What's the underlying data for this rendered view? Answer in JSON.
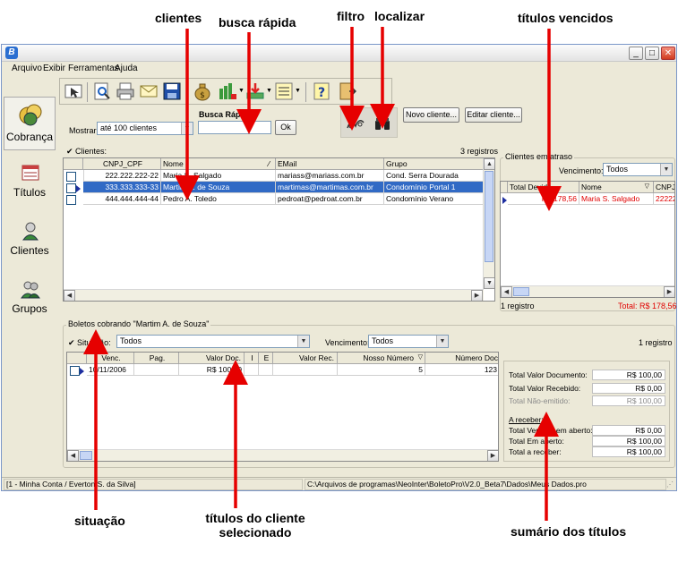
{
  "annotations": {
    "clientes": "clientes",
    "busca_rapida": "busca rápida",
    "filtro": "filtro",
    "localizar": "localizar",
    "titulos_vencidos": "títulos vencidos",
    "situacao": "situação",
    "titulos_cliente_l1": "títulos do cliente",
    "titulos_cliente_l2": "selecionado",
    "sumario": "sumário dos títulos"
  },
  "window": {
    "app_icon": "B"
  },
  "menu": {
    "items": [
      "Arquivo",
      "Exibir",
      "Ferramentas",
      "Ajuda"
    ]
  },
  "sidebar": {
    "items": [
      {
        "label": "Cobrança",
        "icon": "coins-icon"
      },
      {
        "label": "Títulos",
        "icon": "ledger-icon"
      },
      {
        "label": "Clientes",
        "icon": "person-icon"
      },
      {
        "label": "Grupos",
        "icon": "group-icon"
      }
    ]
  },
  "search": {
    "mostrar_label": "Mostrar:",
    "mostrar_value": "até 100 clientes",
    "busca_label": "Busca Rápida",
    "ok": "Ok",
    "novo_cliente": "Novo cliente...",
    "editar_cliente": "Editar cliente..."
  },
  "clients": {
    "label": "Clientes:",
    "count": "3 registros",
    "columns": [
      "CNPJ_CPF",
      "Nome",
      "EMail",
      "Grupo"
    ],
    "rows": [
      {
        "cnpj": "222.222.222-22",
        "nome": "Maria S. Salgado",
        "email": "mariass@mariass.com.br",
        "grupo": "Cond. Serra Dourada"
      },
      {
        "cnpj": "333.333.333-33",
        "nome": "Martim A. de Souza",
        "email": "martimas@martimas.com.br",
        "grupo": "Condomínio Portal 1"
      },
      {
        "cnpj": "444.444.444-44",
        "nome": "Pedro A. Toledo",
        "email": "pedroat@pedroat.com.br",
        "grupo": "Condomínio Verano"
      }
    ]
  },
  "atraso": {
    "title": "Clientes em atraso",
    "vencimento_label": "Vencimento:",
    "vencimento_value": "Todos",
    "columns": [
      "Total Devido",
      "Nome",
      "CNPJ"
    ],
    "row": {
      "total": "R$ 178,56",
      "nome": "Maria S. Salgado",
      "cnpj": "22222"
    },
    "count": "1 registro",
    "total": "Total: R$ 178,56"
  },
  "boletos": {
    "title": "Boletos cobrando \"Martim A. de Souza\"",
    "situacao_label": "Situação:",
    "situacao_value": "Todos",
    "vencimento_label": "Vencimento:",
    "vencimento_value": "Todos",
    "count": "1 registro",
    "columns": [
      "Venc.",
      "Pag.",
      "Valor Doc.",
      "I",
      "E",
      "Valor Rec.",
      "Nosso Número",
      "Número Doc"
    ],
    "row": {
      "venc": "10/11/2006",
      "pag": "",
      "valor_doc": "R$ 100,00",
      "nosso": "5",
      "numero": "123"
    }
  },
  "summary": {
    "items": [
      {
        "label": "Total Valor Documento:",
        "value": "R$ 100,00"
      },
      {
        "label": "Total Valor Recebido:",
        "value": "R$ 0,00"
      },
      {
        "label": "Total Não-emitido:",
        "value": "R$ 100,00"
      }
    ],
    "receber_title": "A receber:",
    "receber": [
      {
        "label": "Total Vencido em aberto:",
        "value": "R$ 0,00"
      },
      {
        "label": "Total Em aberto:",
        "value": "R$ 100,00"
      },
      {
        "label": "Total a receber:",
        "value": "R$ 100,00"
      }
    ]
  },
  "status": {
    "left": "[1 - Minha Conta / Everton S. da Silva]",
    "path": "C:\\Arquivos de programas\\NeoInter\\BoletoPro\\V2.0_Beta7\\Dados\\Meus Dados.pro"
  },
  "colors": {
    "selection": "#316ac5",
    "overdue": "#e00000",
    "arrow": "#e60000"
  }
}
